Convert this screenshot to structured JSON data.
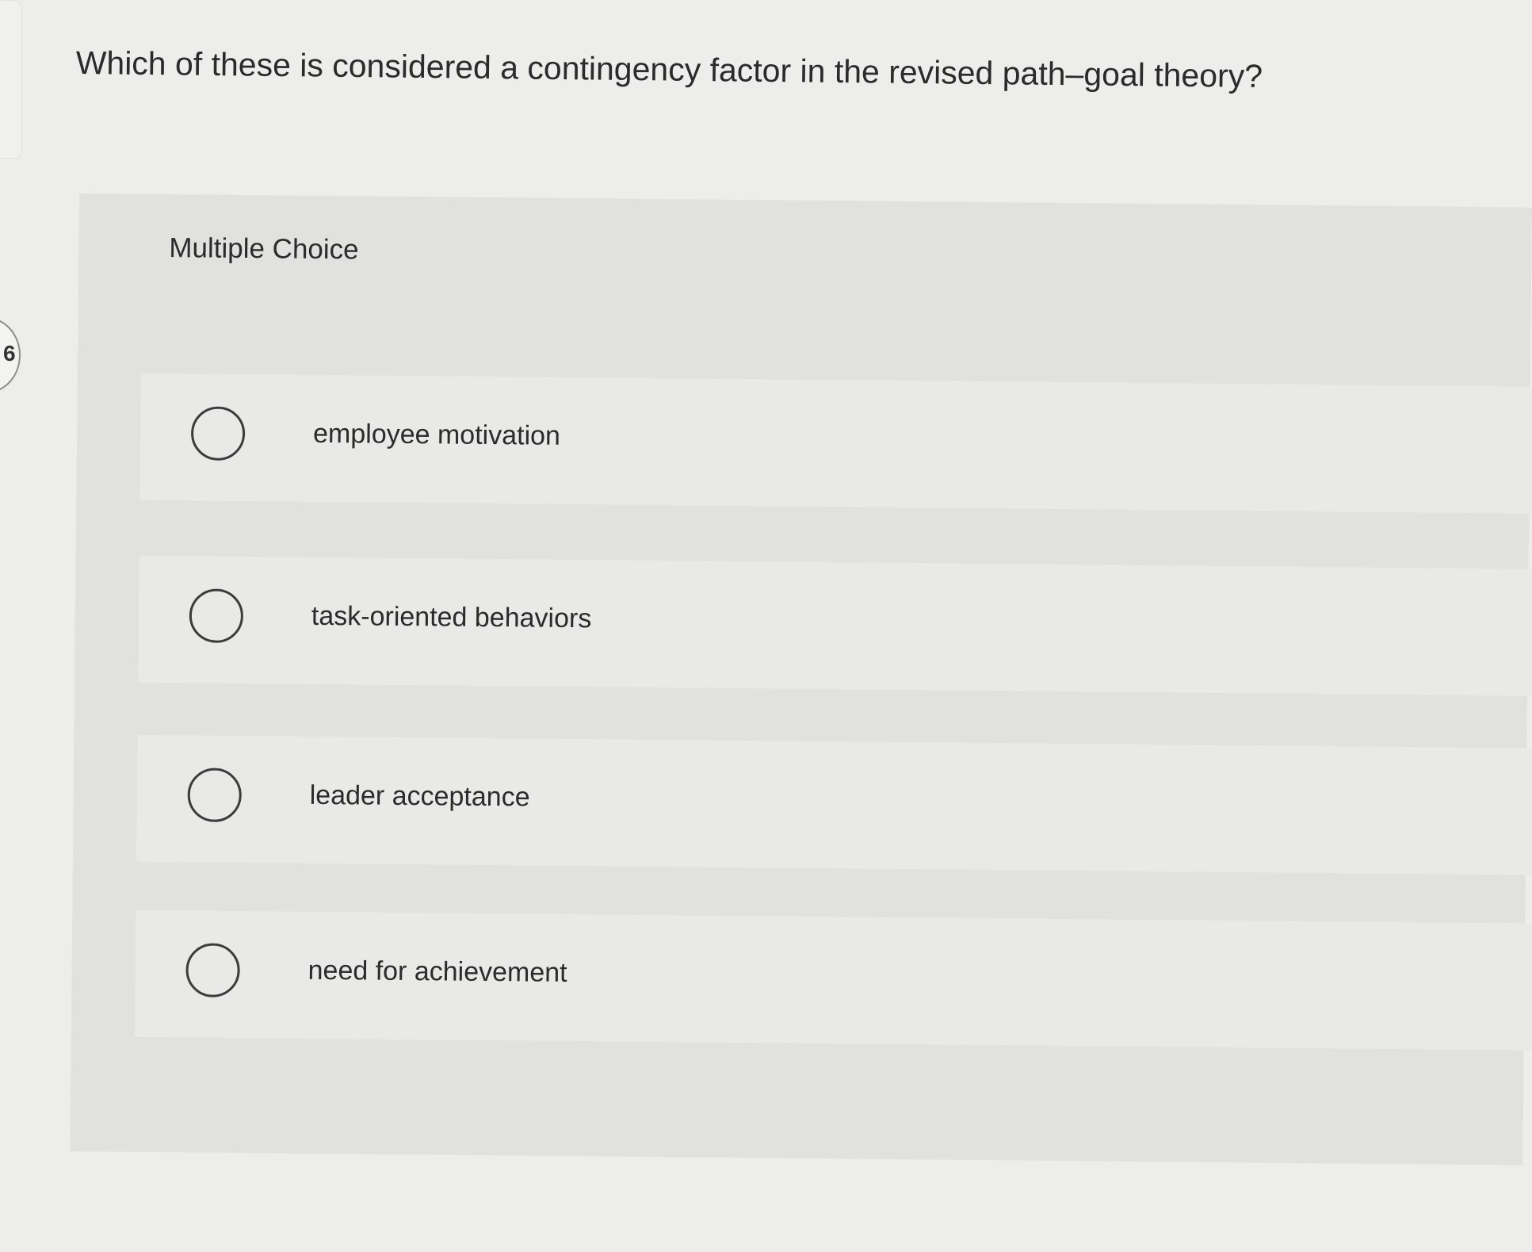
{
  "question": {
    "number": "6",
    "text": "Which of these is considered a contingency factor in the revised path–goal theory?"
  },
  "panel": {
    "type_label": "Multiple Choice"
  },
  "options": [
    {
      "label": "employee motivation",
      "selected": false
    },
    {
      "label": "task-oriented behaviors",
      "selected": false
    },
    {
      "label": "leader acceptance",
      "selected": false
    },
    {
      "label": "need for achievement",
      "selected": false
    }
  ]
}
